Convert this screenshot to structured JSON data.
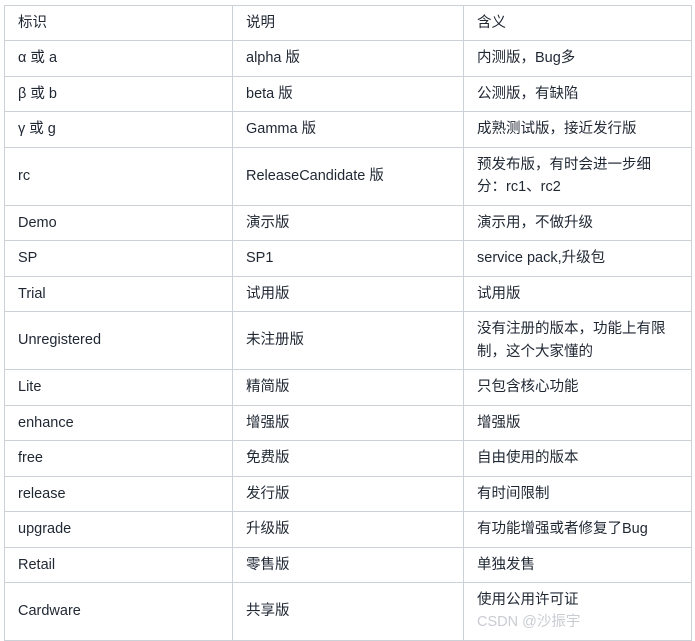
{
  "table": {
    "columns": [
      "标识",
      "说明",
      "含义"
    ],
    "rows": [
      {
        "id": "α 或 a",
        "desc": "alpha 版",
        "meaning": "内测版，Bug多"
      },
      {
        "id": "β 或 b",
        "desc": "beta 版",
        "meaning": "公测版，有缺陷"
      },
      {
        "id": "γ 或 g",
        "desc": "Gamma 版",
        "meaning": "成熟测试版，接近发行版"
      },
      {
        "id": "rc",
        "desc": "ReleaseCandidate 版",
        "meaning": "预发布版，有时会进一步细分：rc1、rc2"
      },
      {
        "id": "Demo",
        "desc": "演示版",
        "meaning": "演示用，不做升级"
      },
      {
        "id": "SP",
        "desc": "SP1",
        "meaning": "service pack,升级包"
      },
      {
        "id": "Trial",
        "desc": "试用版",
        "meaning": "试用版"
      },
      {
        "id": "Unregistered",
        "desc": "未注册版",
        "meaning": "没有注册的版本，功能上有限制，这个大家懂的"
      },
      {
        "id": "Lite",
        "desc": "精简版",
        "meaning": "只包含核心功能"
      },
      {
        "id": "enhance",
        "desc": "增强版",
        "meaning": "增强版"
      },
      {
        "id": "free",
        "desc": "免费版",
        "meaning": "自由使用的版本"
      },
      {
        "id": "release",
        "desc": "发行版",
        "meaning": "有时间限制"
      },
      {
        "id": "upgrade",
        "desc": "升级版",
        "meaning": "有功能增强或者修复了Bug"
      },
      {
        "id": "Retail",
        "desc": "零售版",
        "meaning": "单独发售"
      },
      {
        "id": "Cardware",
        "desc": "共享版",
        "meaning": "使用公用许可证"
      }
    ]
  },
  "watermark": {
    "text": "CSDN @沙振宇",
    "color": "#c9ccd1"
  },
  "colors": {
    "border": "#ccd0d7",
    "text": "#1f2733",
    "background": "#ffffff"
  }
}
